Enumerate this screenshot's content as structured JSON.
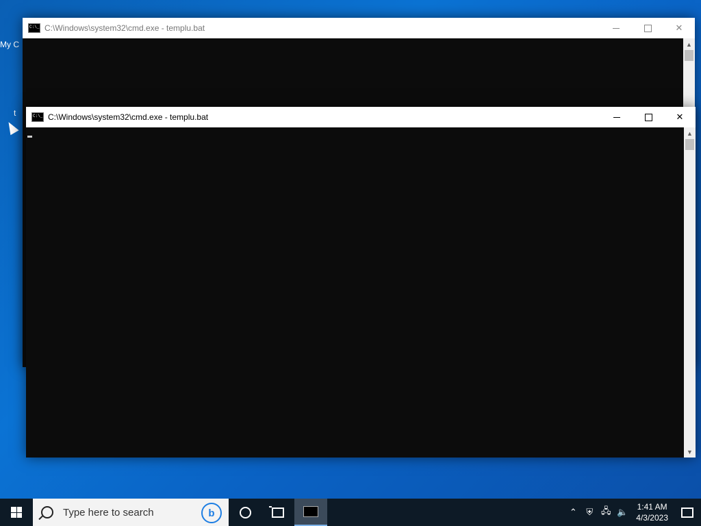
{
  "desktop": {
    "icon1_label": "My C",
    "icon2_label": "t"
  },
  "windows": [
    {
      "title": "C:\\Windows\\system32\\cmd.exe - templu.bat",
      "state": "inactive"
    },
    {
      "title": "C:\\Windows\\system32\\cmd.exe - templu.bat",
      "state": "active"
    }
  ],
  "taskbar": {
    "search_placeholder": "Type here to search",
    "time": "1:41 AM",
    "date": "4/3/2023",
    "accent": "#7eb4ea"
  },
  "icons": [
    "windows-logo-icon",
    "search-icon",
    "bing-icon",
    "cortana-icon",
    "task-view-icon",
    "cmd-icon",
    "chevron-up-icon",
    "security-icon",
    "network-icon",
    "volume-icon",
    "notification-icon"
  ]
}
